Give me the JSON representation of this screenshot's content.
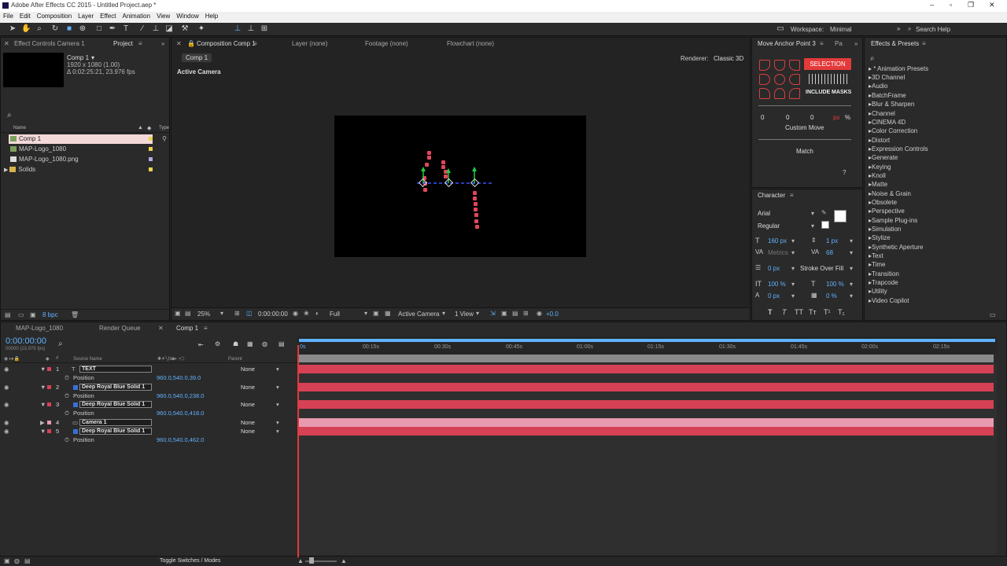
{
  "window": {
    "title": "Adobe After Effects CC 2015 - Untitled Project.aep *"
  },
  "menu": [
    "File",
    "Edit",
    "Composition",
    "Layer",
    "Effect",
    "Animation",
    "View",
    "Window",
    "Help"
  ],
  "toolbar": {
    "workspace_label": "Workspace:",
    "workspace_value": "Minimal",
    "search_help": "Search Help"
  },
  "left_panel": {
    "tabs": [
      "Effect Controls Camera 1",
      "Project"
    ],
    "preview": {
      "name": "Comp 1",
      "line1": "1920 x 1080 (1.00)",
      "line2": "Δ 0:02:25:21, 23.976 fps"
    },
    "search_placeholder": "",
    "columns": {
      "name": "Name",
      "type": "Type"
    },
    "items": [
      {
        "label": "Comp 1",
        "color": "#e8d44d"
      },
      {
        "label": "MAP-Logo_1080",
        "color": "#e8d44d"
      },
      {
        "label": "MAP-Logo_1080.png",
        "color": "#b9a6e0"
      },
      {
        "label": "Solids",
        "color": "#e8d44d"
      }
    ],
    "footer_bpc": "8 bpc"
  },
  "comp_panel": {
    "tabs": [
      "Composition Comp 1",
      "Layer (none)",
      "Footage (none)",
      "Flowchart (none)"
    ],
    "subtab": "Comp 1",
    "renderer_label": "Renderer:",
    "renderer_value": "Classic 3D",
    "view_label": "Active Camera",
    "footer": {
      "zoom": "25%",
      "timecode": "0:00:00:00",
      "resolution": "Full",
      "camera": "Active Camera",
      "views": "1 View",
      "exposure": "+0.0"
    }
  },
  "anchor_panel": {
    "tabs": [
      "Move Anchor Point 3",
      "Pa"
    ],
    "selection_btn": "SELECTION",
    "include_masks": "INCLUDE MASKS",
    "x": "0",
    "y": "0",
    "z": "0",
    "unit_px": "px",
    "unit_pct": "%",
    "custom_move": "Custom Move",
    "match": "Match",
    "help": "?"
  },
  "character_panel": {
    "title": "Character",
    "font": "Arial",
    "style": "Regular",
    "size": "160 px",
    "leading": "1 px",
    "kerning": "Metrics",
    "tracking": "68",
    "stroke": "0 px",
    "stroke_mode": "Stroke Over Fill",
    "vscale": "100 %",
    "hscale": "100 %",
    "baseline": "0 px",
    "tsume": "0 %",
    "caps": [
      "T",
      "T",
      "TT",
      "Tт",
      "T¹",
      "T₁"
    ]
  },
  "effects_panel": {
    "title": "Effects & Presets",
    "items": [
      "* Animation Presets",
      "3D Channel",
      "Audio",
      "BatchFrame",
      "Blur & Sharpen",
      "Channel",
      "CINEMA 4D",
      "Color Correction",
      "Distort",
      "Expression Controls",
      "Generate",
      "Keying",
      "Knoll",
      "Matte",
      "Noise & Grain",
      "Obsolete",
      "Perspective",
      "Sample Plug-ins",
      "Simulation",
      "Stylize",
      "Synthetic Aperture",
      "Text",
      "Time",
      "Transition",
      "Trapcode",
      "Utility",
      "Video Copilot"
    ]
  },
  "timeline": {
    "tabs": [
      "MAP-Logo_1080",
      "Render Queue",
      "Comp 1"
    ],
    "timecode": "0:00:00:00",
    "fps": "00000 (23.976 fps)",
    "col_source": "Source Name",
    "col_parent": "Parent",
    "ruler": [
      "0s",
      "00:15s",
      "00:30s",
      "00:45s",
      "01:00s",
      "01:15s",
      "01:30s",
      "01:45s",
      "02:00s",
      "02:15s"
    ],
    "layers": [
      {
        "num": "1",
        "name": "TEXT",
        "parent": "None",
        "color": "#d64155",
        "prop": "Position",
        "value": "960.0,540.0,39.0"
      },
      {
        "num": "2",
        "name": "Deep Royal Blue Solid 1",
        "parent": "None",
        "color": "#d64155",
        "prop": "Position",
        "value": "960.0,540.0,238.0"
      },
      {
        "num": "3",
        "name": "Deep Royal Blue Solid 1",
        "parent": "None",
        "color": "#d64155",
        "prop": "Position",
        "value": "960.0,540.0,418.0"
      },
      {
        "num": "4",
        "name": "Camera 1",
        "parent": "None",
        "color": "#e89ab0"
      },
      {
        "num": "5",
        "name": "Deep Royal Blue Solid 1",
        "parent": "None",
        "color": "#d64155",
        "prop": "Position",
        "value": "960.0,540.0,462.0"
      }
    ],
    "toggle_label": "Toggle Switches / Modes"
  }
}
